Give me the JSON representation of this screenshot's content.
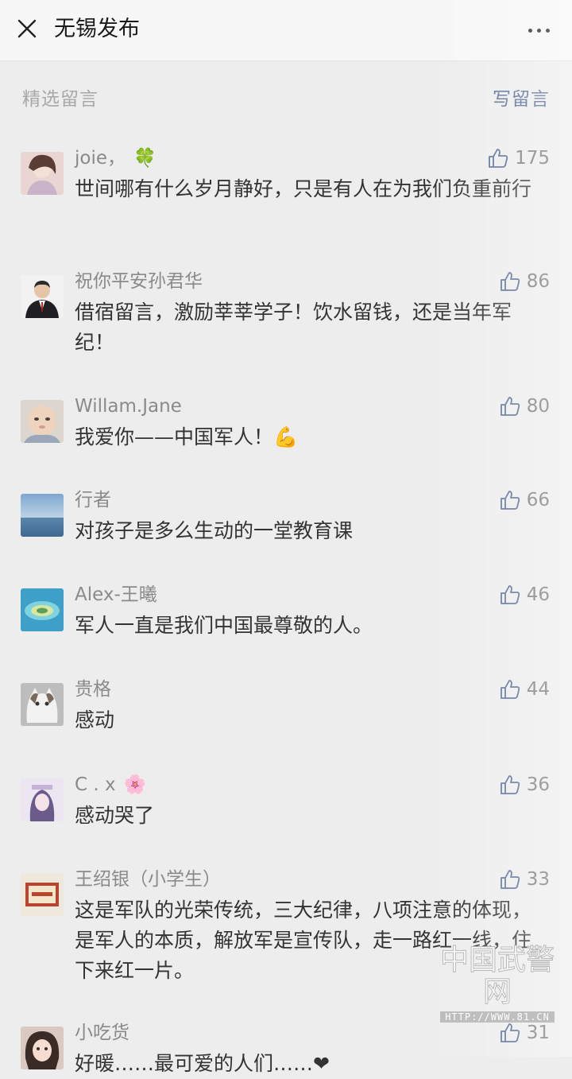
{
  "nav": {
    "title": "无锡发布"
  },
  "section": {
    "label": "精选留言",
    "write": "写留言"
  },
  "comments": [
    {
      "nick": "joie，",
      "emoji": "🍀",
      "likes": "175",
      "text": "世间哪有什么岁月静好，只是有人在为我们负重前行"
    },
    {
      "nick": "祝你平安孙君华",
      "emoji": "",
      "likes": "86",
      "text": "借宿留言，激励莘莘学子！饮水留钱，还是当年军纪！"
    },
    {
      "nick": "Willam.Jane",
      "emoji": "",
      "likes": "80",
      "text": "我爱你——中国军人！💪"
    },
    {
      "nick": "行者",
      "emoji": "",
      "likes": "66",
      "text": "对孩子是多么生动的一堂教育课"
    },
    {
      "nick": "Alex-王曦",
      "emoji": "",
      "likes": "46",
      "text": "军人一直是我们中国最尊敬的人。"
    },
    {
      "nick": "贵格",
      "emoji": "",
      "likes": "44",
      "text": "感动"
    },
    {
      "nick": "C . x",
      "emoji": "🌸",
      "likes": "36",
      "text": "感动哭了"
    },
    {
      "nick": "王绍银（小学生）",
      "emoji": "",
      "likes": "33",
      "text": "这是军队的光荣传统，三大纪律，八项注意的体现，是军人的本质，解放军是宣传队，走一路红一线，住下来红一片。"
    },
    {
      "nick": "小吃货",
      "emoji": "",
      "likes": "31",
      "text": "好暖……最可爱的人们……❤"
    }
  ],
  "watermark": {
    "text": "中国武警网",
    "url": "HTTP://WWW.81.CN"
  },
  "colors": {
    "link": "#576b95",
    "nick": "#8a8a8a",
    "background": "#ededed"
  }
}
